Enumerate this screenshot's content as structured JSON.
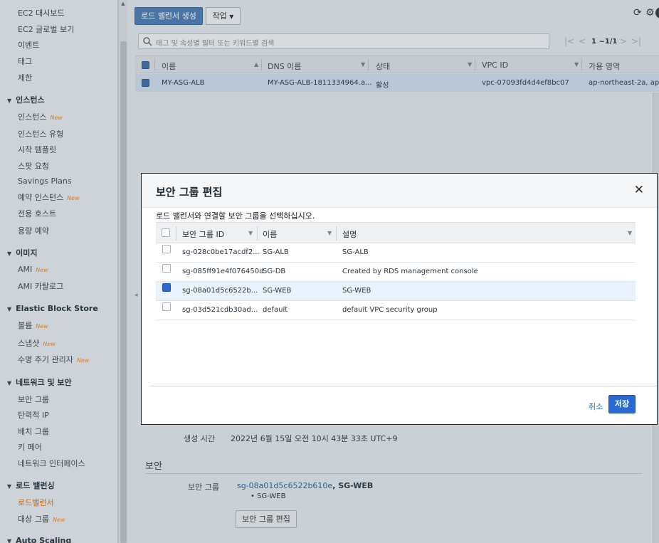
{
  "sidebar": {
    "items_top": [
      {
        "label": "EC2 대시보드"
      },
      {
        "label": "EC2 글로벌 보기"
      },
      {
        "label": "이벤트"
      },
      {
        "label": "태그"
      },
      {
        "label": "제한"
      }
    ],
    "sections": [
      {
        "title": "인스턴스",
        "items": [
          {
            "label": "인스턴스",
            "badge": "New"
          },
          {
            "label": "인스턴스 유형"
          },
          {
            "label": "시작 템플릿"
          },
          {
            "label": "스팟 요청"
          },
          {
            "label": "Savings Plans"
          },
          {
            "label": "예약 인스턴스",
            "badge": "New"
          },
          {
            "label": "전용 호스트"
          },
          {
            "label": "용량 예약"
          }
        ]
      },
      {
        "title": "이미지",
        "items": [
          {
            "label": "AMI",
            "badge": "New"
          },
          {
            "label": "AMI 카탈로그"
          }
        ]
      },
      {
        "title": "Elastic Block Store",
        "items": [
          {
            "label": "볼륨",
            "badge": "New"
          },
          {
            "label": "스냅샷",
            "badge": "New"
          },
          {
            "label": "수명 주기 관리자",
            "badge": "New"
          }
        ]
      },
      {
        "title": "네트워크 및 보안",
        "items": [
          {
            "label": "보안 그룹"
          },
          {
            "label": "탄력적 IP"
          },
          {
            "label": "배치 그룹"
          },
          {
            "label": "키 페어"
          },
          {
            "label": "네트워크 인터페이스"
          }
        ]
      },
      {
        "title": "로드 밸런싱",
        "items": [
          {
            "label": "로드밸런서",
            "active": true
          },
          {
            "label": "대상 그룹",
            "badge": "New"
          }
        ]
      },
      {
        "title": "Auto Scaling",
        "items": []
      }
    ]
  },
  "toolbar": {
    "create_label": "로드 밸런서 생성",
    "actions_label": "작업",
    "search_placeholder": "태그 및 속성별 필터 또는 키워드별 검색",
    "pager_text": "1 ~1/1"
  },
  "table": {
    "columns": [
      "이름",
      "DNS 이름",
      "상태",
      "VPC ID",
      "가용 영역"
    ],
    "rows": [
      {
        "name": "MY-ASG-ALB",
        "dns": "MY-ASG-ALB-1811334964.a...",
        "state": "활성",
        "vpc": "vpc-07093fd4d4ef8bc07",
        "az": "ap-northeast-2a, ap-no"
      }
    ]
  },
  "detail": {
    "created_label": "생성 시간",
    "created_value": "2022년 6월 15일 오전 10시 43분 33초 UTC+9",
    "security_heading": "보안",
    "sg_label": "보안 그룹",
    "sg_link": "sg-08a01d5c6522b610e",
    "sg_name": ", SG-WEB",
    "sg_sub": "• SG-WEB",
    "edit_button": "보안 그룹 편집"
  },
  "modal": {
    "title": "보안 그룹 편집",
    "description": "로드 밸런서와 연결할 보안 그룹을 선택하십시오.",
    "columns": [
      "보안 그룹 ID",
      "이름",
      "설명"
    ],
    "rows": [
      {
        "id": "sg-028c0be17acdf2...",
        "name": "SG-ALB",
        "desc": "SG-ALB",
        "checked": false
      },
      {
        "id": "sg-085ff91e4f076450d",
        "name": "SG-DB",
        "desc": "Created by RDS management console",
        "checked": false
      },
      {
        "id": "sg-08a01d5c6522b...",
        "name": "SG-WEB",
        "desc": "SG-WEB",
        "checked": true
      },
      {
        "id": "sg-03d521cdb30ad...",
        "name": "default",
        "desc": "default VPC security group",
        "checked": false
      }
    ],
    "cancel_label": "취소",
    "save_label": "저장"
  }
}
